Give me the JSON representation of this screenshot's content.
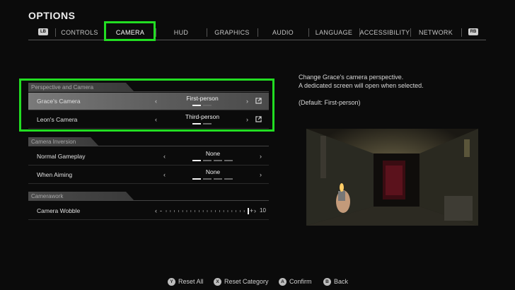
{
  "header": {
    "title": "OPTIONS"
  },
  "tabs": {
    "left_bumper": "LB",
    "right_bumper": "RB",
    "items": [
      "CONTROLS",
      "CAMERA",
      "HUD",
      "GRAPHICS",
      "AUDIO",
      "LANGUAGE",
      "ACCESSIBILITY",
      "NETWORK"
    ],
    "active": "CAMERA"
  },
  "sections": {
    "perspective": {
      "title": "Perspective and Camera",
      "rows": [
        {
          "label": "Grace's Camera",
          "value": "First-person",
          "selected": true,
          "option_index": 0,
          "option_count": 2
        },
        {
          "label": "Leon's Camera",
          "value": "Third-person",
          "selected": false,
          "option_index": 0,
          "option_count": 2
        }
      ]
    },
    "inversion": {
      "title": "Camera Inversion",
      "rows": [
        {
          "label": "Normal Gameplay",
          "value": "None",
          "option_index": 0,
          "option_count": 4
        },
        {
          "label": "When Aiming",
          "value": "None",
          "option_index": 0,
          "option_count": 4
        }
      ]
    },
    "camerawork": {
      "title": "Camerawork",
      "rows": [
        {
          "label": "Camera Wobble",
          "minus": "-",
          "plus": "+",
          "value": "10",
          "min": 0,
          "max": 10
        }
      ]
    }
  },
  "arrows": {
    "left": "‹",
    "right": "›"
  },
  "description": {
    "line1": "Change Grace's camera perspective.",
    "line2": "A dedicated screen will open when selected.",
    "default": "(Default: First-person)"
  },
  "footer": {
    "items": [
      {
        "button": "Y",
        "label": "Reset All"
      },
      {
        "button": "X",
        "label": "Reset Category"
      },
      {
        "button": "A",
        "label": "Confirm"
      },
      {
        "button": "B",
        "label": "Back"
      }
    ]
  },
  "colors": {
    "highlight": "#22dd22",
    "background": "#0b0b0b"
  },
  "icons": {
    "external": "external-link-icon"
  }
}
